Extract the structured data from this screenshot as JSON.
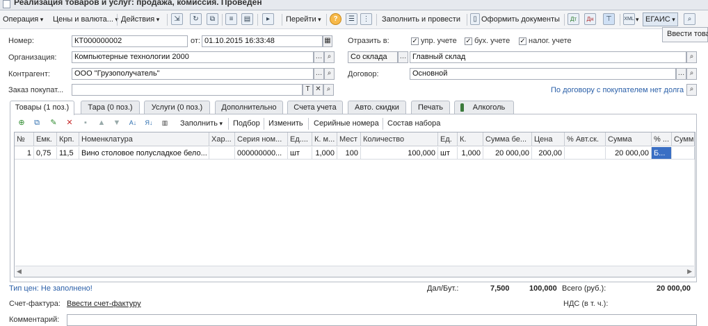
{
  "window": {
    "title": "Реализация товаров и услуг: продажа, комиссия. Проведен"
  },
  "toolbar": {
    "operation": "Операция",
    "prices": "Цены и валюта...",
    "actions": "Действия",
    "goto": "Перейти",
    "help": "?",
    "fill_post": "Заполнить и провести",
    "make_docs": "Оформить документы",
    "egais": "ЕГАИС"
  },
  "popup": {
    "item": "Ввести това"
  },
  "header": {
    "number_label": "Номер:",
    "number": "КТ000000002",
    "from_label": "от:",
    "date": "01.10.2015 16:33:48",
    "reflect_label": "Отразить в:",
    "upr": "упр. учете",
    "buh": "бух. учете",
    "nalog": "налог. учете",
    "org_label": "Организация:",
    "org": "Компьютерные технологии 2000",
    "warehouse_mode": "Со склада",
    "warehouse": "Главный склад",
    "contractor_label": "Контрагент:",
    "contractor": "ООО \"Грузополучатель\"",
    "contract_label": "Договор:",
    "contract": "Основной",
    "order_label": "Заказ покупат...",
    "order": "",
    "debt_note": "По договору с покупателем нет долга"
  },
  "tabs": [
    {
      "label": "Товары (1 поз.)"
    },
    {
      "label": "Тара (0 поз.)"
    },
    {
      "label": "Услуги (0 поз.)"
    },
    {
      "label": "Дополнительно"
    },
    {
      "label": "Счета учета"
    },
    {
      "label": "Авто. скидки"
    },
    {
      "label": "Печать"
    },
    {
      "label": "Алкоголь"
    }
  ],
  "grid_toolbar": {
    "fill": "Заполнить",
    "select": "Подбор",
    "change": "Изменить",
    "serials": "Серийные номера",
    "kit": "Состав набора"
  },
  "grid": {
    "columns": [
      "№",
      "Емк.",
      "Крп.",
      "Номенклатура",
      "Хар...",
      "Серия ном...",
      "Ед....",
      "К. м...",
      "Мест",
      "Количество",
      "Ед.",
      "К.",
      "Сумма бе...",
      "Цена",
      "% Авт.ск.",
      "Сумма",
      "% ...",
      "Сумма"
    ],
    "rows": [
      [
        "1",
        "0,75",
        "11,5",
        "Вино столовое полусладкое бело...",
        "",
        "000000000...",
        "шт",
        "1,000",
        "100",
        "100,000",
        "шт",
        "1,000",
        "20 000,00",
        "200,00",
        "",
        "20 000,00",
        "Б...",
        ""
      ]
    ]
  },
  "footer": {
    "price_type": "Тип цен: Не заполнено!",
    "dal_label": "Дал/Бут.:",
    "dal": "7,500",
    "but": "100,000",
    "total_label": "Всего (руб.):",
    "total": "20 000,00",
    "invoice_label": "Счет-фактура:",
    "invoice_link": "Ввести счет-фактуру",
    "vat_label": "НДС (в т. ч.):",
    "comment_label": "Комментарий:"
  },
  "colors": {
    "accent": "#2a5fa8",
    "selected_cell": "#3a6fc4"
  }
}
